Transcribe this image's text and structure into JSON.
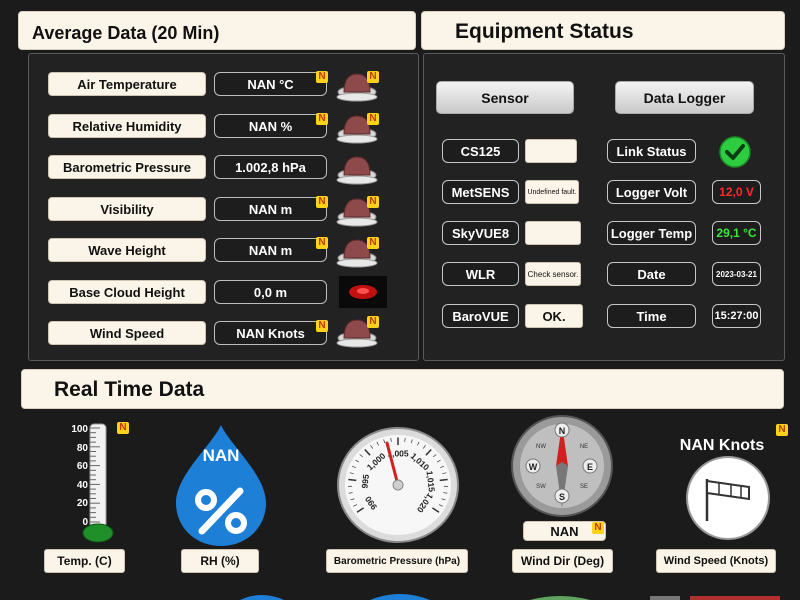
{
  "average": {
    "title": "Average Data (20 Min)",
    "rows": [
      {
        "label": "Air Temperature",
        "value": "NAN °C",
        "flag": "N"
      },
      {
        "label": "Relative Humidity",
        "value": "NAN %",
        "flag": "N"
      },
      {
        "label": "Barometric Pressure",
        "value": "1.002,8 hPa",
        "flag": ""
      },
      {
        "label": "Visibility",
        "value": "NAN m",
        "flag": "N"
      },
      {
        "label": "Wave Height",
        "value": "NAN m",
        "flag": "N"
      },
      {
        "label": "Base Cloud Height",
        "value": "0,0 m",
        "flag": ""
      },
      {
        "label": "Wind Speed",
        "value": "NAN Knots",
        "flag": "N"
      }
    ]
  },
  "equipment": {
    "title": "Equipment Status",
    "sensor_header": "Sensor",
    "logger_header": "Data Logger",
    "sensors": [
      {
        "name": "CS125",
        "status": ""
      },
      {
        "name": "MetSENS",
        "status": "Undefined fault."
      },
      {
        "name": "SkyVUE8",
        "status": ""
      },
      {
        "name": "WLR",
        "status": "Check sensor."
      },
      {
        "name": "BaroVUE",
        "status": "OK."
      }
    ],
    "logger": [
      {
        "name": "Link Status",
        "value": ""
      },
      {
        "name": "Logger Volt",
        "value": "12,0 V",
        "color": "#ff2a2a"
      },
      {
        "name": "Logger Temp",
        "value": "29,1 °C",
        "color": "#39e639"
      },
      {
        "name": "Date",
        "value": "2023-03-21",
        "color": "#ffffff"
      },
      {
        "name": "Time",
        "value": "15:27:00",
        "color": "#ffffff"
      }
    ]
  },
  "realtime": {
    "title": "Real Time Data",
    "thermo_ticks": [
      "100",
      "80",
      "60",
      "40",
      "20",
      "0"
    ],
    "thermo_flag": "N",
    "rh_value": "NAN",
    "wind_dir_value": "NAN",
    "wind_dir_flag": "N",
    "wind_speed_value": "NAN Knots",
    "wind_speed_flag": "N",
    "baro_ticks": [
      "990",
      "995",
      "1,000",
      "1,005",
      "1,010",
      "1,015",
      "1,020"
    ],
    "compass": {
      "n": "N",
      "ne": "NE",
      "e": "E",
      "se": "SE",
      "s": "S",
      "sw": "SW",
      "w": "W",
      "nw": "NW"
    },
    "labels": {
      "temp": "Temp. (C)",
      "rh": "RH (%)",
      "baro": "Barometric Pressure (hPa)",
      "wind_dir": "Wind Dir (Deg)",
      "wind_speed": "Wind Speed (Knots)"
    }
  },
  "colors": {
    "panel_bg": "#1b1b1b",
    "header_bg": "#fbf4e8",
    "ok_green": "#2ecc40",
    "alarm_red": "#ff2a2a",
    "rh_blue": "#1e7fd6"
  }
}
